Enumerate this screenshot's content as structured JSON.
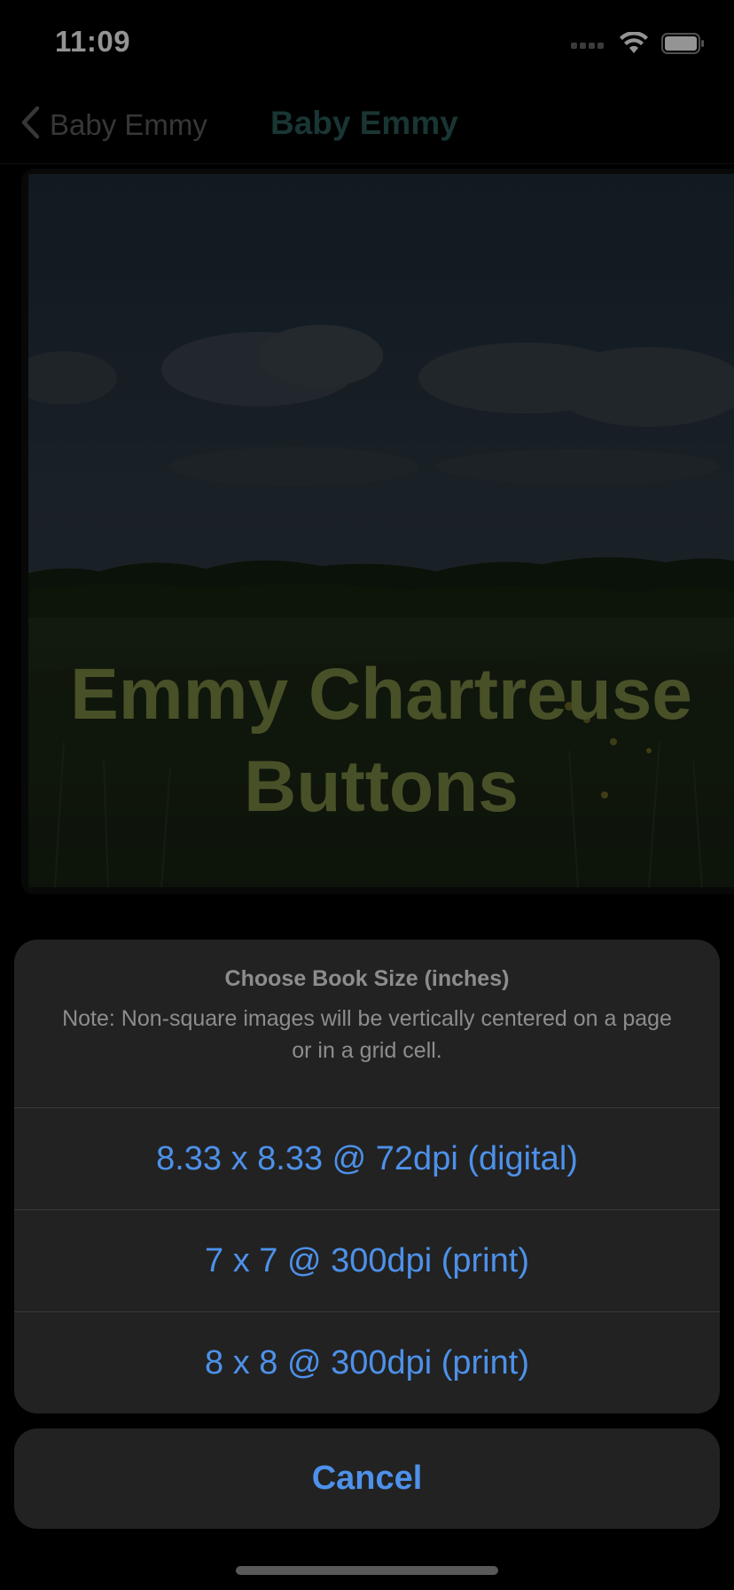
{
  "status_bar": {
    "time": "11:09",
    "icons": [
      "cellular-signal-icon",
      "wifi-icon",
      "battery-icon"
    ]
  },
  "nav": {
    "back_label": "Baby Emmy",
    "title": "Baby Emmy"
  },
  "cover": {
    "title_line1": "Emmy Chartreuse",
    "title_line2": "Buttons"
  },
  "action_sheet": {
    "title": "Choose Book Size (inches)",
    "message": "Note: Non-square images will be vertically centered on a page or in a grid cell.",
    "options": [
      {
        "label": "8.33 x 8.33 @ 72dpi (digital)"
      },
      {
        "label": "7 x 7 @ 300dpi (print)"
      },
      {
        "label": "8 x 8 @ 300dpi (print)"
      }
    ],
    "cancel_label": "Cancel"
  },
  "colors": {
    "accent": "#4d91ea",
    "nav_title": "#2c5c5a",
    "cover_title": "#7d8a45",
    "sheet_background": "#222222"
  }
}
